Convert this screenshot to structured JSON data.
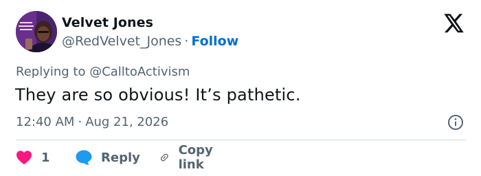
{
  "author": {
    "name": "Velvet Jones",
    "handle": "@RedVelvet_Jones",
    "separator": "·",
    "follow_label": "Follow"
  },
  "reply_to": "Replying to @CalltoActivism",
  "tweet": {
    "text": "They are so obvious! It’s pathetic."
  },
  "meta": {
    "time": "12:40 AM",
    "separator": "·",
    "date": "Aug 21, 2026"
  },
  "actions": {
    "like_count": "1",
    "reply_label": "Reply",
    "copy_label": "Copy link"
  },
  "icons": {
    "logo": "x-logo-icon",
    "info": "info-icon",
    "like": "heart-icon",
    "reply": "speech-bubble-icon",
    "copy": "link-icon"
  },
  "colors": {
    "heart": "#f91880",
    "reply_bubble": "#1d9bf0",
    "follow": "#006fd6",
    "secondary_text": "#536471",
    "divider": "#cfd9de"
  }
}
